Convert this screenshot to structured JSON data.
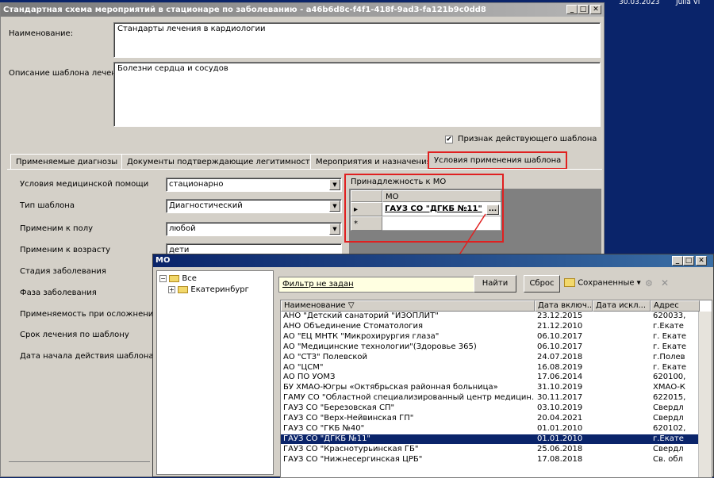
{
  "taskbar": {
    "date": "30.03.2023",
    "user": "Julia Vi"
  },
  "window": {
    "title": "Стандартная схема мероприятий в стационаре по заболеванию - a46b6d8c-f4f1-418f-9ad3-fa121b9c0dd8",
    "buttons": {
      "minimize": "_",
      "maximize": "□",
      "close": "✕"
    }
  },
  "form": {
    "name_label": "Наименование:",
    "name_value": "Стандарты лечения в кардиологии",
    "desc_label": "Описание шаблона лечения:",
    "desc_value": "Болезни сердца и сосудов",
    "active_checkbox_label": "Признак действующего шаблона",
    "active_checked": "✔"
  },
  "tabs": [
    {
      "label": "Применяемые диагнозы"
    },
    {
      "label": "Документы подтверждающие легитимность"
    },
    {
      "label": "Мероприятия и назначения"
    },
    {
      "label": "Условия применения шаблона"
    }
  ],
  "conditions": {
    "care_label": "Условия медицинской помощи",
    "care_value": "стационарно",
    "type_label": "Тип шаблона",
    "type_value": "Диагностический",
    "gender_label": "Применим к полу",
    "gender_value": "любой",
    "age_label": "Применим к возрасту",
    "age_value": "дети",
    "stage_label": "Стадия заболевания",
    "phase_label": "Фаза заболевания",
    "complications_label": "Применяемость при осложнени",
    "duration_label": "Срок лечения по шаблону",
    "start_label": "Дата начала действия шаблона"
  },
  "mo_section": {
    "title": "Принадлежность к МО",
    "column": "МО",
    "row_value": "ГАУЗ СО \"ДГКБ №11\"",
    "ellipsis": "...",
    "row_marker": "▸",
    "new_marker": "*"
  },
  "popup": {
    "title": "МО",
    "tree": {
      "root": "Все",
      "child": "Екатеринбург"
    },
    "filter_text": "Фильтр не задан",
    "find_label": "Найти",
    "reset_label": "Сброс",
    "saved_label": "Сохраненные ▾",
    "columns": [
      "Наименование ▽",
      "Дата включ...",
      "Дата искл...",
      "Адрес"
    ],
    "rows": [
      {
        "name": "АНО \"Детский санаторий \"ИЗОПЛИТ\"",
        "date": "23.12.2015",
        "excl": "",
        "addr": "620033,"
      },
      {
        "name": "АНО Объединение Стоматология",
        "date": "21.12.2010",
        "excl": "",
        "addr": "г.Екате"
      },
      {
        "name": "АО \"ЕЦ МНТК \"Микрохирургия глаза\"",
        "date": "06.10.2017",
        "excl": "",
        "addr": "г. Екате"
      },
      {
        "name": "АО \"Медицинские технологии\"(Здоровье 365)",
        "date": "06.10.2017",
        "excl": "",
        "addr": "г. Екате"
      },
      {
        "name": "АО \"СТЗ\" Полевской",
        "date": "24.07.2018",
        "excl": "",
        "addr": "г.Полев"
      },
      {
        "name": "АО \"ЦСМ\"",
        "date": "16.08.2019",
        "excl": "",
        "addr": "г. Екате"
      },
      {
        "name": "АО ПО УОМЗ",
        "date": "17.06.2014",
        "excl": "",
        "addr": "620100,"
      },
      {
        "name": "БУ ХМАО-Югры «Октябрьская районная больница»",
        "date": "31.10.2019",
        "excl": "",
        "addr": "ХМАО-К"
      },
      {
        "name": "ГАМУ СО \"Областной специализированный центр медицин...",
        "date": "30.11.2017",
        "excl": "",
        "addr": "622015,"
      },
      {
        "name": "ГАУЗ СО \"Березовская СП\"",
        "date": "03.10.2019",
        "excl": "",
        "addr": "Свердл"
      },
      {
        "name": "ГАУЗ СО \"Верх-Нейвинская ГП\"",
        "date": "20.04.2021",
        "excl": "",
        "addr": "Свердл"
      },
      {
        "name": "ГАУЗ СО \"ГКБ №40\"",
        "date": "01.01.2010",
        "excl": "",
        "addr": "620102,"
      },
      {
        "name": "ГАУЗ СО \"ДГКБ №11\"",
        "date": "01.01.2010",
        "excl": "",
        "addr": "г.Екате"
      },
      {
        "name": "ГАУЗ СО \"Краснотурьинская ГБ\"",
        "date": "25.06.2018",
        "excl": "",
        "addr": "Свердл"
      },
      {
        "name": "ГАУЗ СО \"Нижнесергинская ЦРБ\"",
        "date": "17.08.2018",
        "excl": "",
        "addr": "Св. обл"
      }
    ],
    "selected_index": 12,
    "buttons": {
      "minimize": "_",
      "maximize": "□",
      "close": "✕"
    }
  },
  "colors": {
    "highlight": "#e02020",
    "selection": "#0a246a"
  }
}
